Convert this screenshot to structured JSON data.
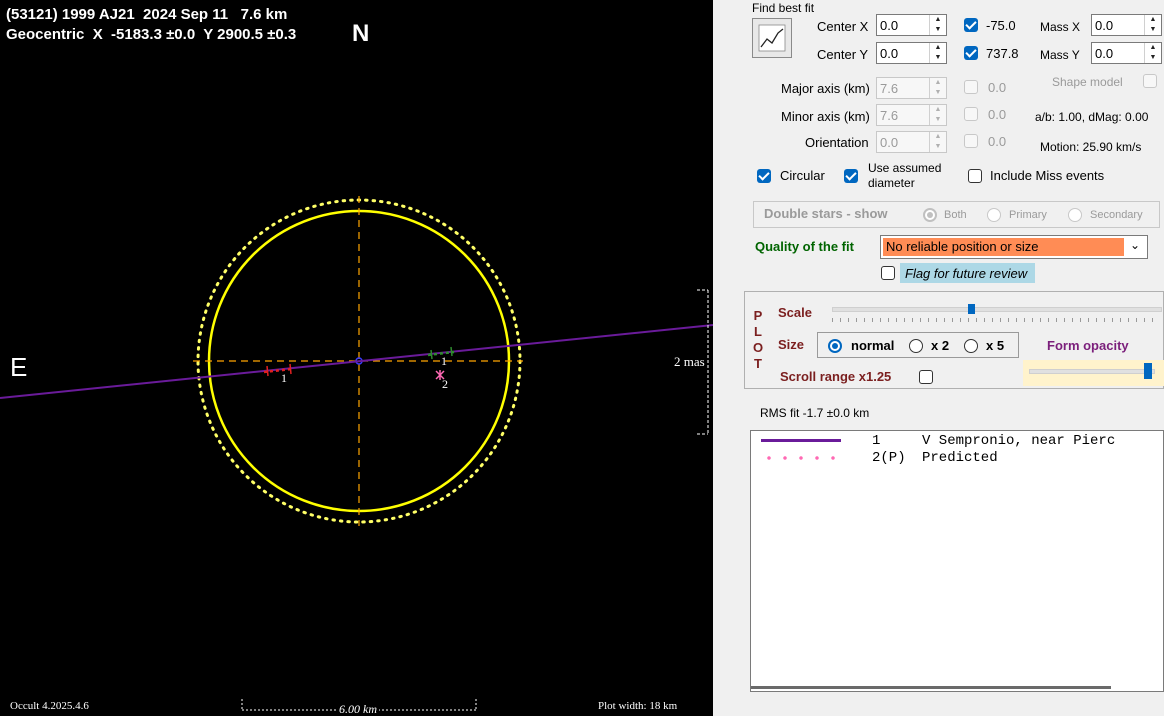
{
  "plot": {
    "title_line1": "(53121) 1999 AJ21  2024 Sep 11   7.6 km",
    "title_line2": "Geocentric  X  -5183.3 ±0.0  Y 2900.5 ±0.3",
    "north": "N",
    "east": "E",
    "scale_label": "2 mas",
    "scale_bar": "6.00 km",
    "version": "Occult 4.2025.4.6",
    "plot_width": "Plot width: 18 km",
    "obs_label_1": "1",
    "obs_label_1b": "1",
    "obs_label_2": "2",
    "colors": {
      "background": "#000000",
      "asteroid_outline": "#ffff00",
      "axis_lines": "#ffa500",
      "chord": "#6a1b9a",
      "miss_dash": "#e02020",
      "predicted": "#ff69b4"
    }
  },
  "panel": {
    "find_best_fit": "Find best fit",
    "center_x_label": "Center X",
    "center_x": "0.0",
    "center_x_check": "-75.0",
    "mass_x_label": "Mass X",
    "mass_x": "0.0",
    "center_y_label": "Center Y",
    "center_y": "0.0",
    "center_y_check": "737.8",
    "mass_y_label": "Mass Y",
    "mass_y": "0.0",
    "major_label": "Major axis (km)",
    "major": "7.6",
    "major_check": "0.0",
    "shape_model": "Shape model",
    "minor_label": "Minor axis (km)",
    "minor": "7.6",
    "minor_check": "0.0",
    "ab_text": "a/b: 1.00, dMag: 0.00",
    "orient_label": "Orientation",
    "orient": "0.0",
    "orient_check": "0.0",
    "motion": "Motion: 25.90 km/s",
    "circular": "Circular",
    "use_assumed_1": "Use assumed",
    "use_assumed_2": "diameter",
    "include_miss": "Include Miss events",
    "double_stars": "Double stars - show",
    "both": "Both",
    "primary": "Primary",
    "secondary": "Secondary",
    "quality_label": "Quality of the fit",
    "quality_value": "No reliable position or size",
    "flag_review": "Flag for future review",
    "plot_letters": [
      "P",
      "L",
      "O",
      "T"
    ],
    "scale_label": "Scale",
    "size_label": "Size",
    "size_normal": "normal",
    "size_x2": "x 2",
    "size_x5": "x 5",
    "form_opacity": "Form opacity",
    "scroll_range": "Scroll range x1.25",
    "rms_fit": "RMS fit -1.7 ±0.0 km",
    "legend": [
      {
        "num": "1",
        "text": "V Sempronio, near Pierc"
      },
      {
        "num": "2(P)",
        "text": "Predicted"
      }
    ],
    "colors": {
      "accent": "#0067c0",
      "quality_bg": "#ff8c55",
      "quality_text": "#006400",
      "flag_bg": "#add8e6",
      "plot_text": "#7b1f1f",
      "form_opacity": "#7b1f7b"
    }
  }
}
